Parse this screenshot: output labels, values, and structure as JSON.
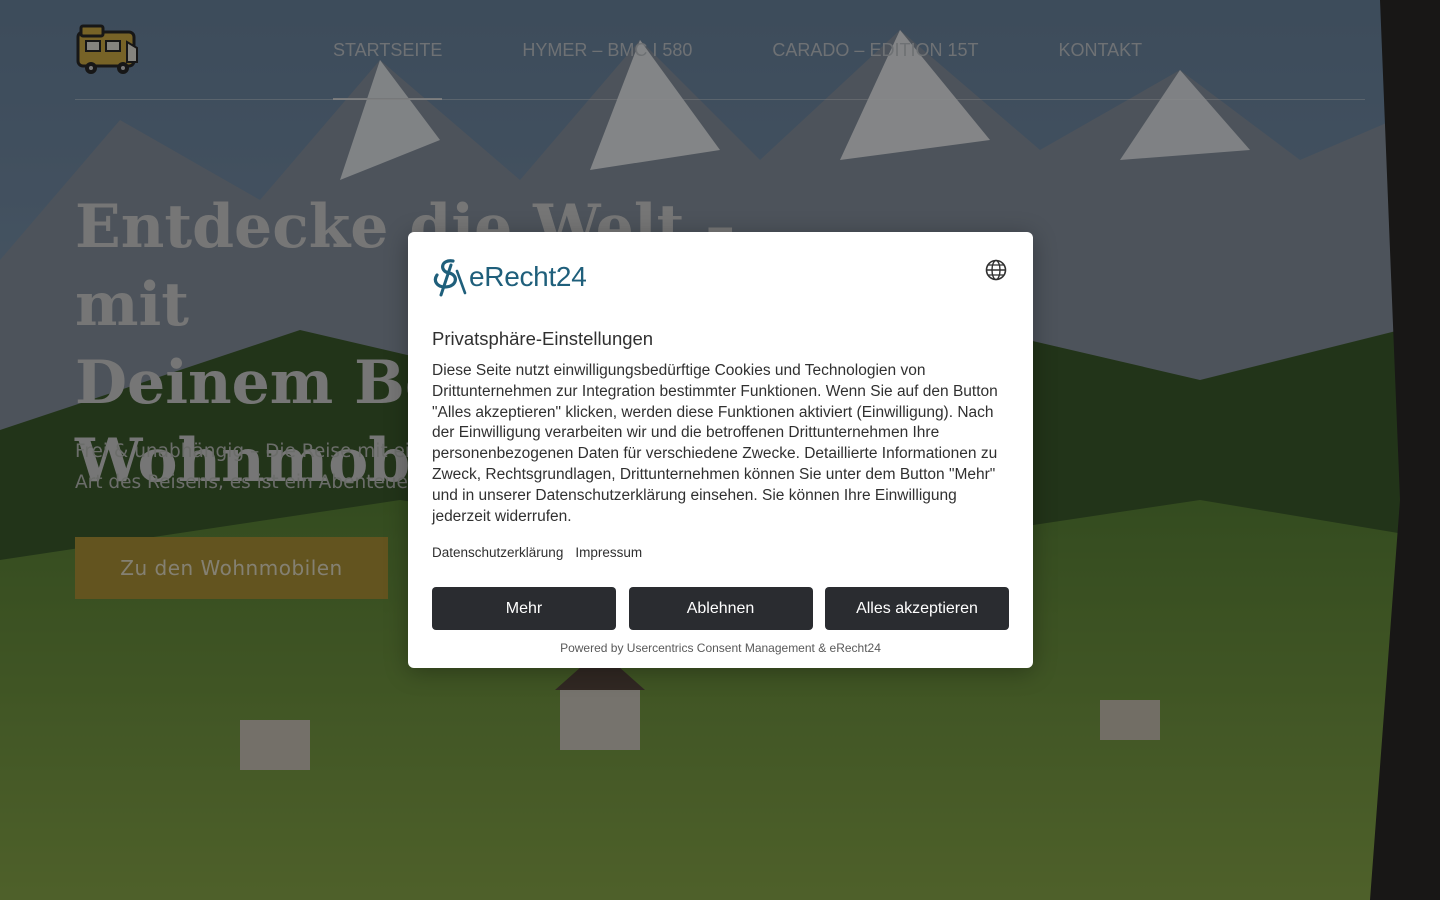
{
  "header": {
    "logo_icon": "camper-van-icon",
    "nav": [
      {
        "label": "STARTSEITE",
        "active": true
      },
      {
        "label": "HYMER – BMC I 580",
        "active": false
      },
      {
        "label": "CARADO – EDITION 15T",
        "active": false
      },
      {
        "label": "KONTAKT",
        "active": false
      }
    ]
  },
  "hero": {
    "title_lines": [
      "Entdecke die Welt – mit",
      "Deinem Bergfex",
      "Wohnmobil"
    ],
    "text_lines": [
      "Frei & unabhängig – Die Reise mit einem Wohnmobil ist mehr als nur eine",
      "Art des Reisens, es ist ein Abenteuer"
    ],
    "button_label": "Zu den Wohnmobilen"
  },
  "consent": {
    "brand": "eRecht24",
    "language_icon": "globe-icon",
    "title": "Privatsphäre-Einstellungen",
    "body": "Diese Seite nutzt einwilligungsbedürftige Cookies und Technologien von Drittunternehmen zur Integration bestimmter Funktionen. Wenn Sie auf den Button \"Alles akzeptieren\" klicken, werden diese Funktionen aktiviert (Einwilligung). Nach der Einwilligung verarbeiten wir und die betroffenen Drittunternehmen Ihre personenbezogenen Daten für verschiedene Zwecke. Detaillierte Informationen zu Zweck, Rechtsgrundlagen, Drittunternehmen können Sie unter dem Button \"Mehr\" und in unserer Datenschutzerklärung einsehen. Sie können Ihre Einwilligung jederzeit widerrufen.",
    "links": [
      "Datenschutzerklärung",
      "Impressum"
    ],
    "buttons": {
      "more": "Mehr",
      "decline": "Ablehnen",
      "accept_all": "Alles akzeptieren"
    },
    "powered_by": "Powered by Usercentrics Consent Management & eRecht24"
  },
  "colors": {
    "accent_button": "#b59a3a",
    "dialog_button": "#2a2c30",
    "brand_blue": "#1f5f7b"
  }
}
